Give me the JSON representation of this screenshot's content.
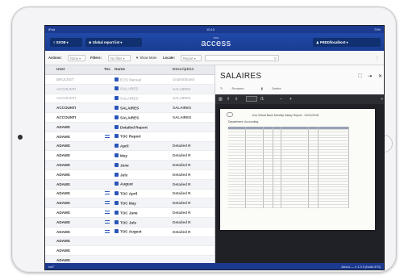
{
  "status_bar": {
    "left": "iPad",
    "time": "10:10",
    "battery": "73%"
  },
  "header": {
    "left_select": "SSOB",
    "report_select": "Global report list",
    "logo_top": "eos",
    "logo_main": "access",
    "user_select": "PBDD/localhost"
  },
  "toolbar": {
    "actions_label": "Actions:",
    "actions_value": "None",
    "filters_label": "Filters:",
    "filters_value": "No filter",
    "show_more": "Show More",
    "locate_label": "Locate:",
    "locate_value": "Report",
    "more_menu": "⋮"
  },
  "grid": {
    "columns": [
      "User",
      "Toc",
      "Name",
      "Description"
    ],
    "rows": [
      {
        "user": "BRUCKET",
        "toc": "",
        "name": "EOS Manual",
        "desc": "Undistributed",
        "style": "muted"
      },
      {
        "user": "ACCOUNTI",
        "toc": "",
        "name": "SALAIRES",
        "desc": "SALAIRES",
        "style": "muted"
      },
      {
        "user": "ACCOUNTI",
        "toc": "",
        "name": "SALAIRES",
        "desc": "SALAIRES",
        "style": "muted"
      },
      {
        "user": "ACCOUNTI",
        "toc": "",
        "name": "SALAIRES",
        "desc": "SALAIRES",
        "style": "strong"
      },
      {
        "user": "ACCOUNTI",
        "toc": "",
        "name": "SALAIRES",
        "desc": "SALAIRES",
        "style": "strong"
      },
      {
        "user": "ADAMS",
        "toc": "",
        "name": "Detailed Report",
        "desc": "",
        "style": "strong"
      },
      {
        "user": "ADAMS",
        "toc": "toc",
        "name": "TOC Report",
        "desc": "",
        "style": "strong"
      },
      {
        "user": "ADAMS",
        "toc": "",
        "name": "April",
        "desc": "Detailed R",
        "style": "strong"
      },
      {
        "user": "ADAMS",
        "toc": "",
        "name": "May",
        "desc": "Detailed R",
        "style": "strong"
      },
      {
        "user": "ADAMS",
        "toc": "",
        "name": "June",
        "desc": "Detailed R",
        "style": "strong"
      },
      {
        "user": "ADAMS",
        "toc": "",
        "name": "July",
        "desc": "Detailed R",
        "style": "strong"
      },
      {
        "user": "ADAMS",
        "toc": "",
        "name": "August",
        "desc": "Detailed R",
        "style": "strong"
      },
      {
        "user": "ADAMS",
        "toc": "toc",
        "name": "TOC April",
        "desc": "Detailed R",
        "style": "strong"
      },
      {
        "user": "ADAMS",
        "toc": "toc",
        "name": "TOC May",
        "desc": "Detailed R",
        "style": "strong"
      },
      {
        "user": "ADAMS",
        "toc": "toc",
        "name": "TOC June",
        "desc": "Detailed R",
        "style": "strong"
      },
      {
        "user": "ADAMS",
        "toc": "toc",
        "name": "TOC July",
        "desc": "Detailed R",
        "style": "strong"
      },
      {
        "user": "ADAMS",
        "toc": "toc",
        "name": "TOC August",
        "desc": "Detailed R",
        "style": "strong"
      },
      {
        "user": "ADAMS",
        "toc": "",
        "name": "",
        "desc": "",
        "style": "strong"
      },
      {
        "user": "ADAMS",
        "toc": "",
        "name": "",
        "desc": "",
        "style": "strong"
      },
      {
        "user": "ADAMS",
        "toc": "",
        "name": "",
        "desc": "",
        "style": "strong"
      }
    ]
  },
  "panel": {
    "title": "SALAIRES",
    "action_1": "Rename",
    "action_2": "Delete",
    "page_indicator": "/1",
    "zoom_minus": "−",
    "zoom_plus": "+",
    "doc_title": "Eos Virtual Bank Monthly Salary Report - 01/01/2018",
    "doc_department": "Department: Accounting"
  },
  "footer": {
    "left": "red°",
    "right": "About  —  v 1.3.0 (build 479)"
  },
  "colors": {
    "brand_blue": "#1a3d93",
    "accent_blue": "#2a55b8"
  }
}
